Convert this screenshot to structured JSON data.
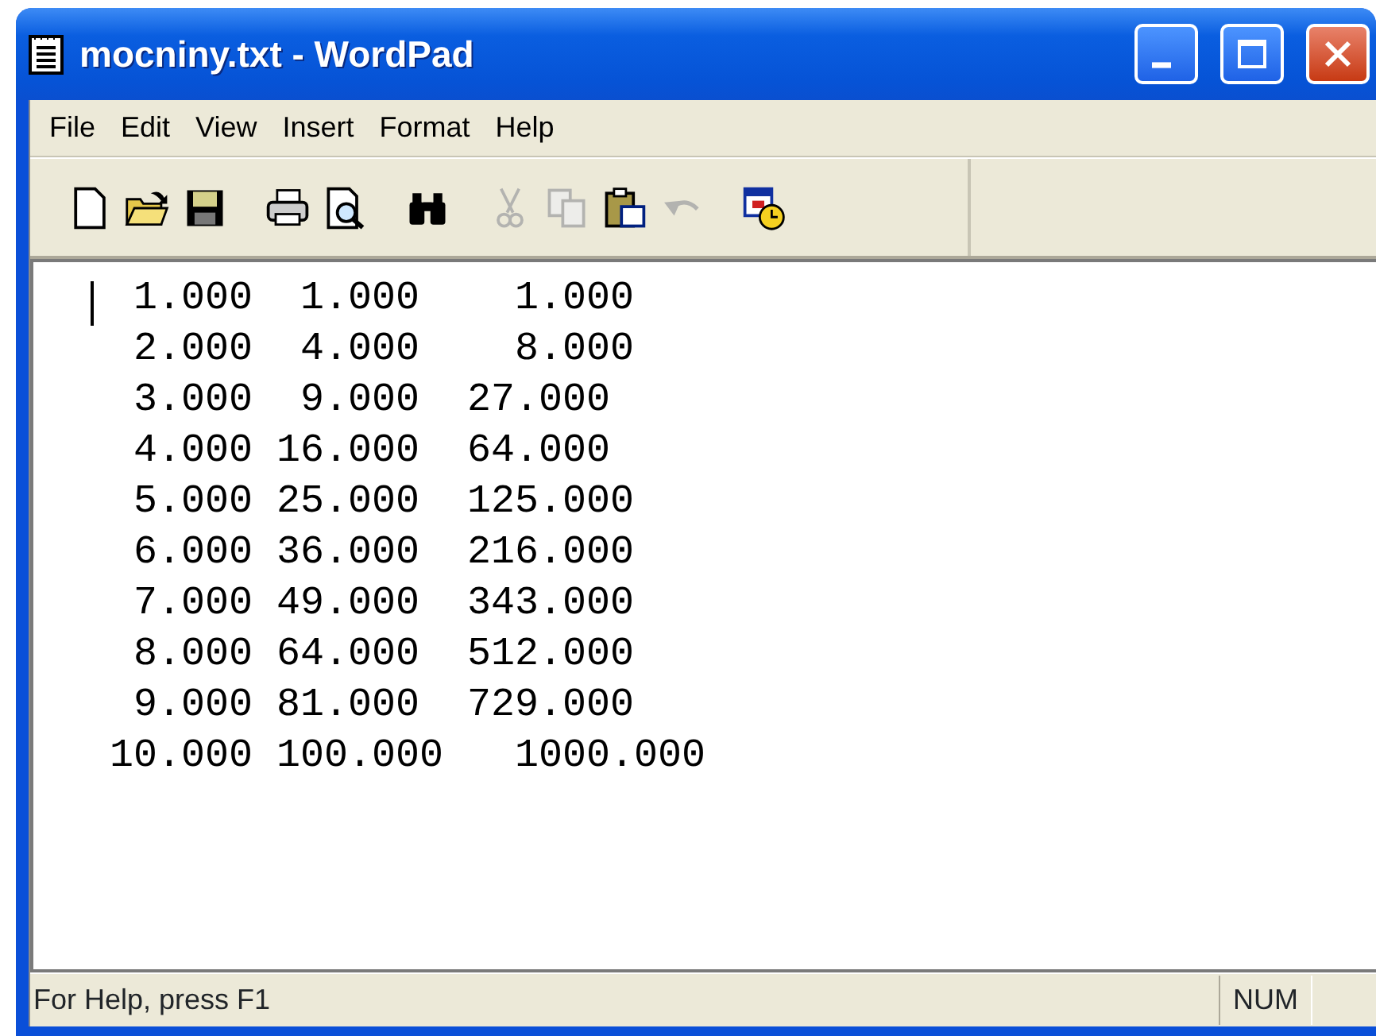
{
  "window": {
    "title": "mocniny.txt - WordPad",
    "controls": [
      {
        "kind": "minimize"
      },
      {
        "kind": "maximize"
      },
      {
        "kind": "close"
      }
    ]
  },
  "menu": [
    "File",
    "Edit",
    "View",
    "Insert",
    "Format",
    "Help"
  ],
  "toolbar": [
    {
      "kind": "new",
      "disabled": false
    },
    {
      "kind": "open",
      "disabled": false
    },
    {
      "kind": "save",
      "disabled": false
    },
    {
      "kind": "gap"
    },
    {
      "kind": "print",
      "disabled": false
    },
    {
      "kind": "preview",
      "disabled": false
    },
    {
      "kind": "gap"
    },
    {
      "kind": "find",
      "disabled": false
    },
    {
      "kind": "gap"
    },
    {
      "kind": "cut",
      "disabled": true
    },
    {
      "kind": "copy",
      "disabled": true
    },
    {
      "kind": "paste",
      "disabled": false
    },
    {
      "kind": "undo",
      "disabled": true
    },
    {
      "kind": "gap"
    },
    {
      "kind": "datetime",
      "disabled": false
    }
  ],
  "document": {
    "lines": [
      " 1.000  1.000    1.000",
      " 2.000  4.000    8.000",
      " 3.000  9.000  27.000",
      " 4.000 16.000  64.000",
      " 5.000 25.000  125.000",
      " 6.000 36.000  216.000",
      " 7.000 49.000  343.000",
      " 8.000 64.000  512.000",
      " 9.000 81.000  729.000",
      "10.000 100.000   1000.000"
    ]
  },
  "status_bar": {
    "text": "For Help, press F1",
    "indicators": [
      "NUM"
    ]
  }
}
